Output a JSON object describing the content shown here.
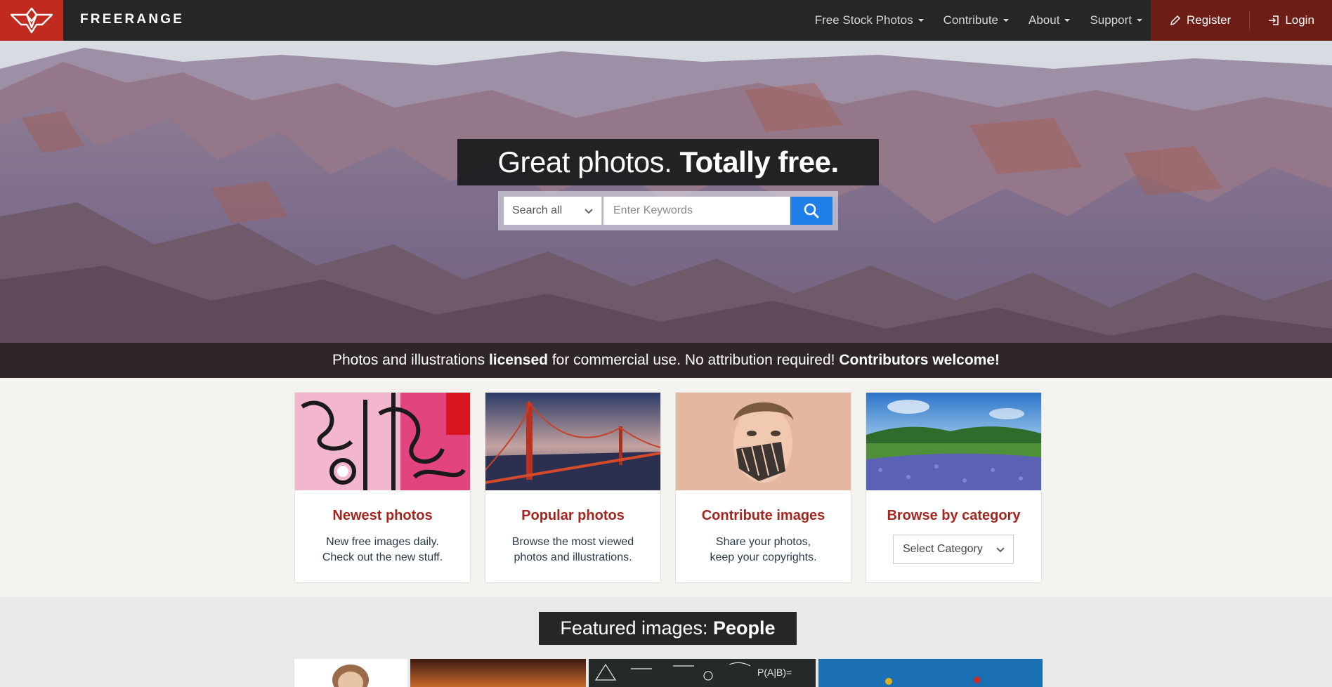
{
  "nav": {
    "brand": "FREERANGE",
    "menu": [
      {
        "label": "Free Stock Photos"
      },
      {
        "label": "Contribute"
      },
      {
        "label": "About"
      },
      {
        "label": "Support"
      }
    ],
    "register": "Register",
    "login": "Login"
  },
  "hero": {
    "headline_light": "Great photos.",
    "headline_bold": "Totally free.",
    "search": {
      "scope": "Search all",
      "placeholder": "Enter Keywords"
    },
    "tagline": {
      "part1": "Photos and illustrations ",
      "bold1": "licensed",
      "part2": " for commercial use. No attribution required! ",
      "bold2": "Contributors welcome!"
    }
  },
  "cards": [
    {
      "title": "Newest photos",
      "line1": "New free images daily.",
      "line2": "Check out the new stuff."
    },
    {
      "title": "Popular photos",
      "line1": "Browse the most viewed",
      "line2": "photos and illustrations."
    },
    {
      "title": "Contribute images",
      "line1": "Share your photos,",
      "line2": "keep your copyrights."
    },
    {
      "title": "Browse by category",
      "select": "Select Category"
    }
  ],
  "featured": {
    "prefix": "Featured images: ",
    "topic": "People"
  },
  "colors": {
    "brand_red": "#c12a1f",
    "account_bg": "#6b1d16",
    "nav_bg": "#262626",
    "card_title": "#a3251e",
    "search_button": "#1f7fe8"
  }
}
